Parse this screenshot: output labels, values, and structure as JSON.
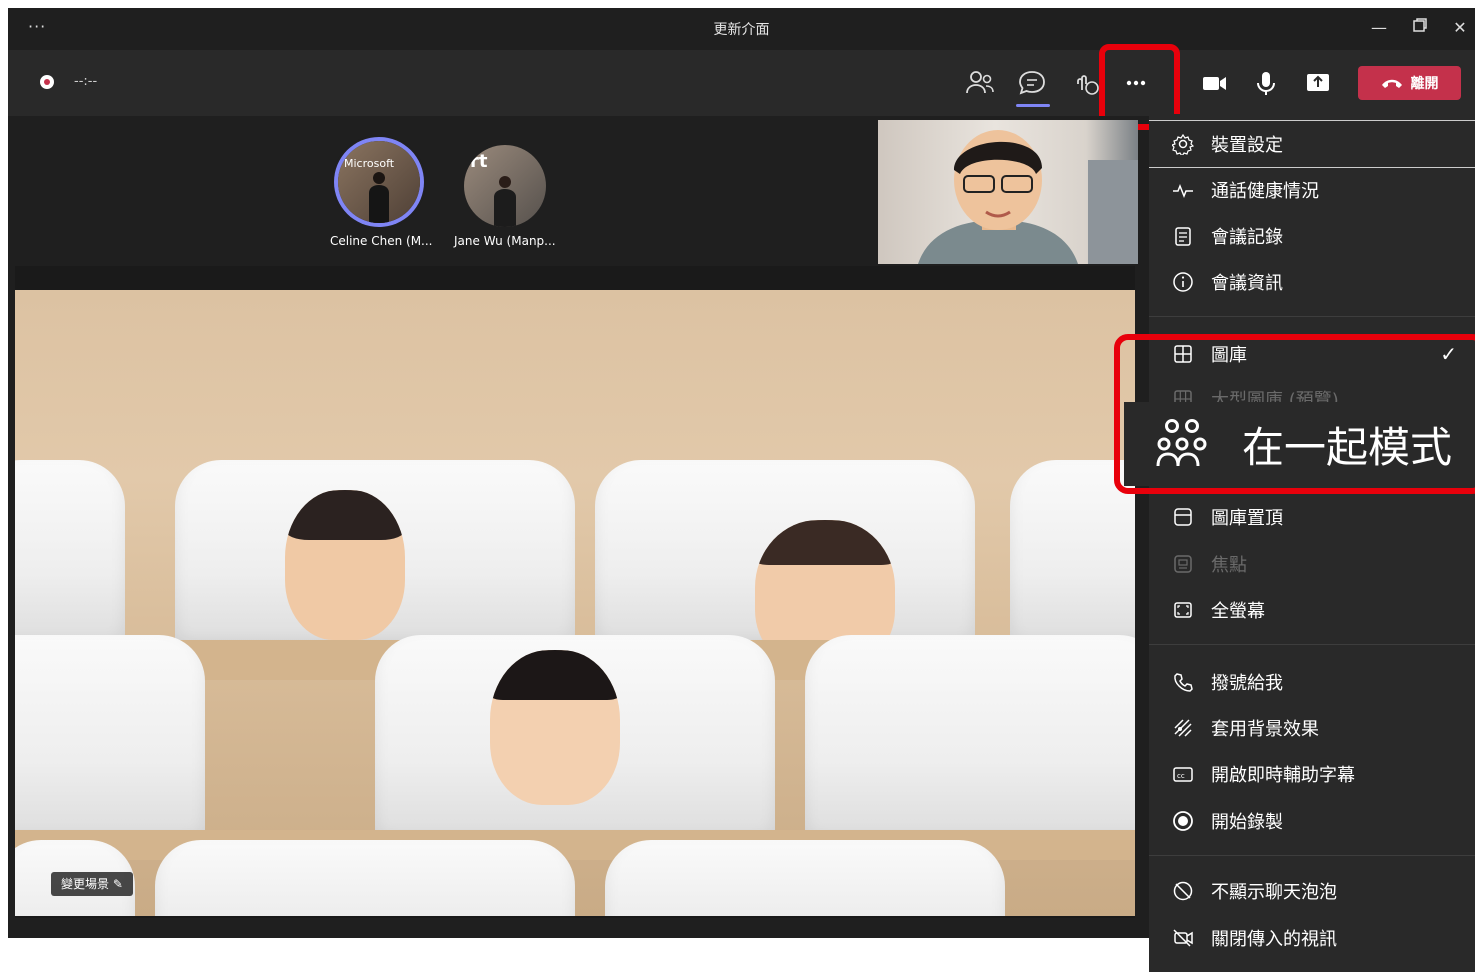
{
  "window": {
    "title": "更新介面",
    "menu_dots": "···",
    "controls": [
      "minimize-icon",
      "restore-icon",
      "close-icon"
    ]
  },
  "toolbar": {
    "timer": "--:--",
    "icons": [
      "participants-icon",
      "chat-icon",
      "reactions-icon",
      "more-options-icon",
      "camera-icon",
      "microphone-icon",
      "share-screen-icon"
    ],
    "leave_label": "離開"
  },
  "participants": [
    {
      "name": "Celine Chen (M...",
      "avatar_text": "Microsoft",
      "speaking": true
    },
    {
      "name": "Jane Wu (Manp...",
      "avatar_text": "rt",
      "speaking": false
    }
  ],
  "stage": {
    "change_scene_label": "變更場景"
  },
  "menu": {
    "items": [
      {
        "label": "裝置設定",
        "icon": "gear-icon",
        "disabled": false
      },
      {
        "label": "通話健康情況",
        "icon": "pulse-icon",
        "disabled": false
      },
      {
        "label": "會議記錄",
        "icon": "notes-icon",
        "disabled": false
      },
      {
        "label": "會議資訊",
        "icon": "info-icon",
        "disabled": false
      },
      {
        "label": "圖庫",
        "icon": "grid-icon",
        "disabled": false,
        "checked": true
      },
      {
        "label": "大型圖庫 (預覽)",
        "icon": "large-grid-icon",
        "disabled": true
      },
      {
        "label": "圖庫置頂",
        "icon": "gallery-top-icon",
        "disabled": false
      },
      {
        "label": "焦點",
        "icon": "focus-icon",
        "disabled": true
      },
      {
        "label": "全螢幕",
        "icon": "fullscreen-icon",
        "disabled": false
      },
      {
        "label": "撥號給我",
        "icon": "phone-icon",
        "disabled": false
      },
      {
        "label": "套用背景效果",
        "icon": "background-effects-icon",
        "disabled": false
      },
      {
        "label": "開啟即時輔助字幕",
        "icon": "captions-icon",
        "disabled": false
      },
      {
        "label": "開始錄製",
        "icon": "record-icon",
        "disabled": false
      },
      {
        "label": "不顯示聊天泡泡",
        "icon": "chat-bubble-off-icon",
        "disabled": false
      },
      {
        "label": "關閉傳入的視訊",
        "icon": "video-off-icon",
        "disabled": false
      }
    ],
    "callout_label": "在一起模式",
    "colors": {
      "highlight": "#e8000b",
      "accent": "#7f85f5",
      "leave": "#c4314b"
    }
  }
}
